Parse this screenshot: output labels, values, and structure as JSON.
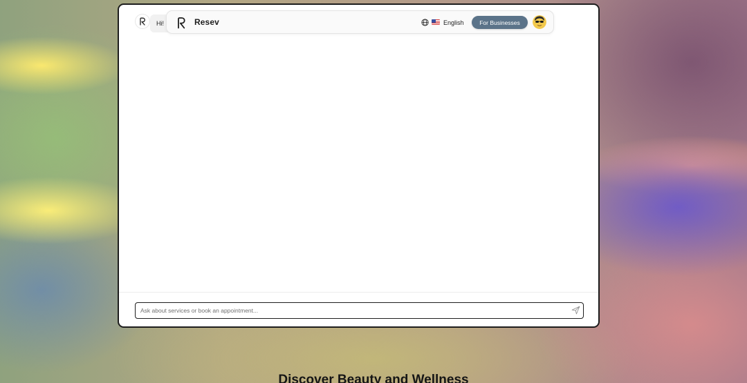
{
  "chat": {
    "greeting": "Hi! I"
  },
  "navbar": {
    "brand": "Resev",
    "language": "English",
    "business_button": "For Businesses"
  },
  "input": {
    "placeholder": "Ask about services or book an appointment..."
  },
  "page": {
    "heading": "Discover Beauty and Wellness"
  },
  "icons": {
    "bot_avatar": "resev-logo-icon",
    "nav_logo": "resev-logo-icon",
    "language": "globe-icon",
    "flag": "us-flag-icon",
    "user": "user-avatar",
    "send": "send-icon"
  },
  "colors": {
    "business_button_bg": "#5b7389",
    "window_border": "#1c1c1c",
    "bubble_bg": "#f1f1f1"
  }
}
